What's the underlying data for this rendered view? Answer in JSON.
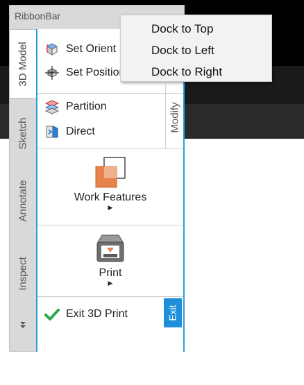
{
  "ribbon": {
    "title": "RibbonBar",
    "tabs": [
      "3D Model",
      "Sketch",
      "Annotate",
      "Inspect"
    ],
    "more_glyph": "⏬",
    "group_label": "Modify",
    "items": {
      "set_orient": "Set Orient",
      "set_position": "Set Position",
      "partition": "Partition",
      "direct": "Direct",
      "work_features": "Work Features",
      "print": "Print",
      "exit_3d_print": "Exit 3D Print",
      "exit_tab": "Exit"
    },
    "accent_color": "#1e90d9"
  },
  "context_menu": {
    "items": [
      "Dock to Top",
      "Dock to Left",
      "Dock to Right"
    ]
  },
  "icons": [
    "orient-cube-icon",
    "position-gizmo-icon",
    "partition-icon",
    "direct-edit-icon",
    "work-features-icon",
    "print-icon",
    "checkmark-icon",
    "expand-more-icon"
  ]
}
